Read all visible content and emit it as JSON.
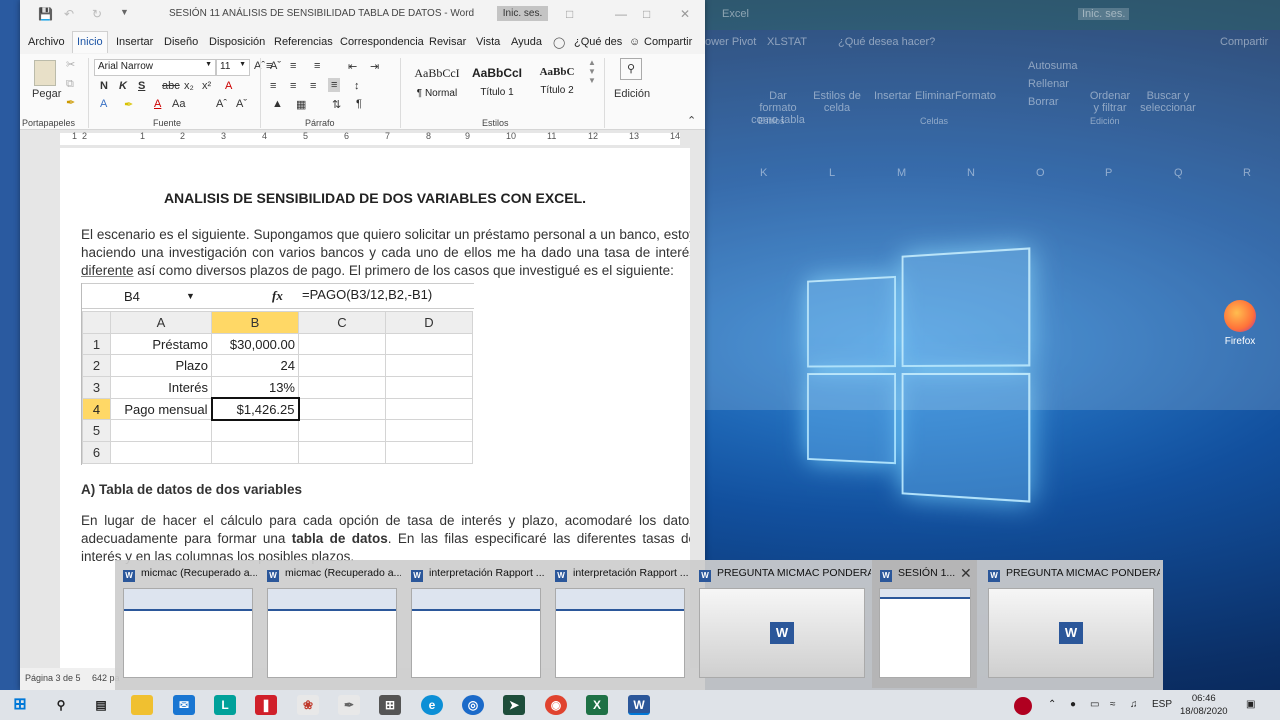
{
  "word": {
    "title": "SESIÓN 11 ANÁLISIS DE SENSIBILIDAD TABLA DE DATOS  -  Word",
    "signin": "Inic. ses.",
    "tabs": [
      "Archivo",
      "Inicio",
      "Insertar",
      "Diseño",
      "Disposición",
      "Referencias",
      "Correspondencia",
      "Revisar",
      "Vista",
      "Ayuda",
      "¿Qué des",
      "Compartir"
    ],
    "ribbon": {
      "paste": "Pegar",
      "font_name": "Arial Narrow",
      "font_size": "11",
      "styles": [
        {
          "preview": "AaBbCcI",
          "name": "¶ Normal"
        },
        {
          "preview": "AaBbCcI",
          "name": "Título 1"
        },
        {
          "preview": "AaBbC",
          "name": "Título 2"
        }
      ],
      "edit": "Edición",
      "groups": [
        "Portapapeles",
        "Fuente",
        "Párrafo",
        "Estilos"
      ]
    },
    "ruler_numbers": [
      "1",
      "2",
      "1",
      "2",
      "3",
      "4",
      "5",
      "6",
      "7",
      "8",
      "9",
      "10",
      "11",
      "12",
      "13",
      "14"
    ],
    "document": {
      "title": "ANALISIS DE SENSIBILIDAD DE DOS VARIABLES CON EXCEL.",
      "para1_a": "El escenario es el siguiente. Supongamos que quiero solicitar un préstamo personal a un banco, estoy haciendo una investigación con varios bancos y cada uno de ellos me ha dado una tasa de interés ",
      "para1_ul": "diferente",
      "para1_b": " así como diversos plazos de pago. El primero de los casos que investigué es el siguiente:",
      "heading": "A)   Tabla de datos de dos variables",
      "para2_a": "En lugar de hacer el cálculo para cada opción de tasa de interés y plazo, acomodaré los datos adecuadamente para formar una ",
      "para2_bold": "tabla de datos",
      "para2_b": ". En las filas especificaré las diferentes tasas de interés y en las columnas los posibles plazos."
    },
    "spreadsheet": {
      "cell_ref": "B4",
      "fx": "fx",
      "formula": "=PAGO(B3/12,B2,-B1)",
      "columns": [
        "A",
        "B",
        "C",
        "D"
      ],
      "rows": [
        {
          "n": "1",
          "a": "Préstamo",
          "b": "$30,000.00"
        },
        {
          "n": "2",
          "a": "Plazo",
          "b": "24"
        },
        {
          "n": "3",
          "a": "Interés",
          "b": "13%"
        },
        {
          "n": "4",
          "a": "Pago mensual",
          "b": "$1,426.25"
        },
        {
          "n": "5",
          "a": "",
          "b": ""
        },
        {
          "n": "6",
          "a": "",
          "b": ""
        }
      ]
    },
    "status": {
      "page": "Página 3 de 5",
      "words": "642 pa"
    }
  },
  "excel_bg": {
    "title": "Excel",
    "signin": "Inic. ses.",
    "tabs": [
      "ower Pivot",
      "XLSTAT",
      "¿Qué desea hacer?",
      "Compartir"
    ],
    "buttons": [
      "Dar formato como tabla",
      "Estilos de celda",
      "Insertar",
      "Eliminar",
      "Formato",
      "Autosuma",
      "Rellenar",
      "Borrar",
      "Ordenar y filtrar",
      "Buscar y seleccionar"
    ],
    "group_labels": [
      "Estilos",
      "Celdas",
      "Edición"
    ],
    "columns": [
      "K",
      "L",
      "M",
      "N",
      "O",
      "P",
      "Q",
      "R"
    ]
  },
  "thumbnails": [
    {
      "title": "micmac (Recuperado a..."
    },
    {
      "title": "micmac (Recuperado a..."
    },
    {
      "title": "interpretación Rapport ..."
    },
    {
      "title": "interpretación Rapport ..."
    },
    {
      "title": "PREGUNTA MICMAC PONDERA..."
    },
    {
      "title": "SESIÓN 1..."
    },
    {
      "title": "PREGUNTA MICMAC PONDERA..."
    }
  ],
  "desktop": {
    "firefox": "Firefox"
  },
  "taskbar": {
    "lang": "ESP",
    "time": "06:46",
    "date": "18/08/2020"
  }
}
